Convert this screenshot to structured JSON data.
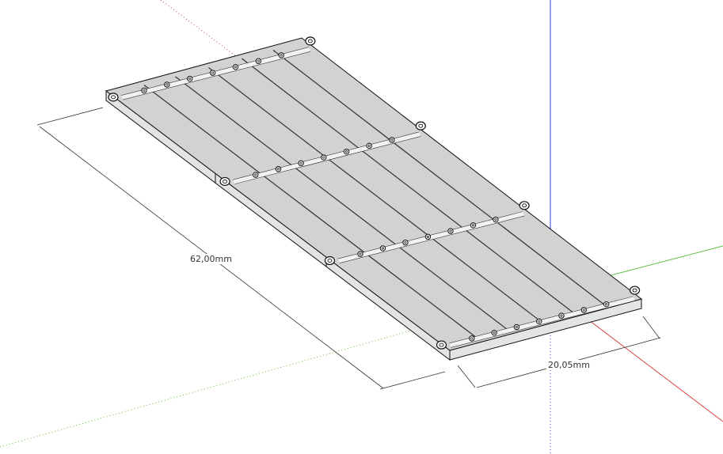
{
  "model": {
    "colors": {
      "face": "#d2d2d2",
      "side": "#e4e4e4",
      "edge": "#111111",
      "axis_red": "#d64545",
      "axis_green": "#5fbf3f",
      "axis_blue": "#2a3fd6",
      "dimension": "#333333"
    }
  },
  "dimensions": {
    "length_label": "62,00mm",
    "width_label": "20,05mm"
  }
}
